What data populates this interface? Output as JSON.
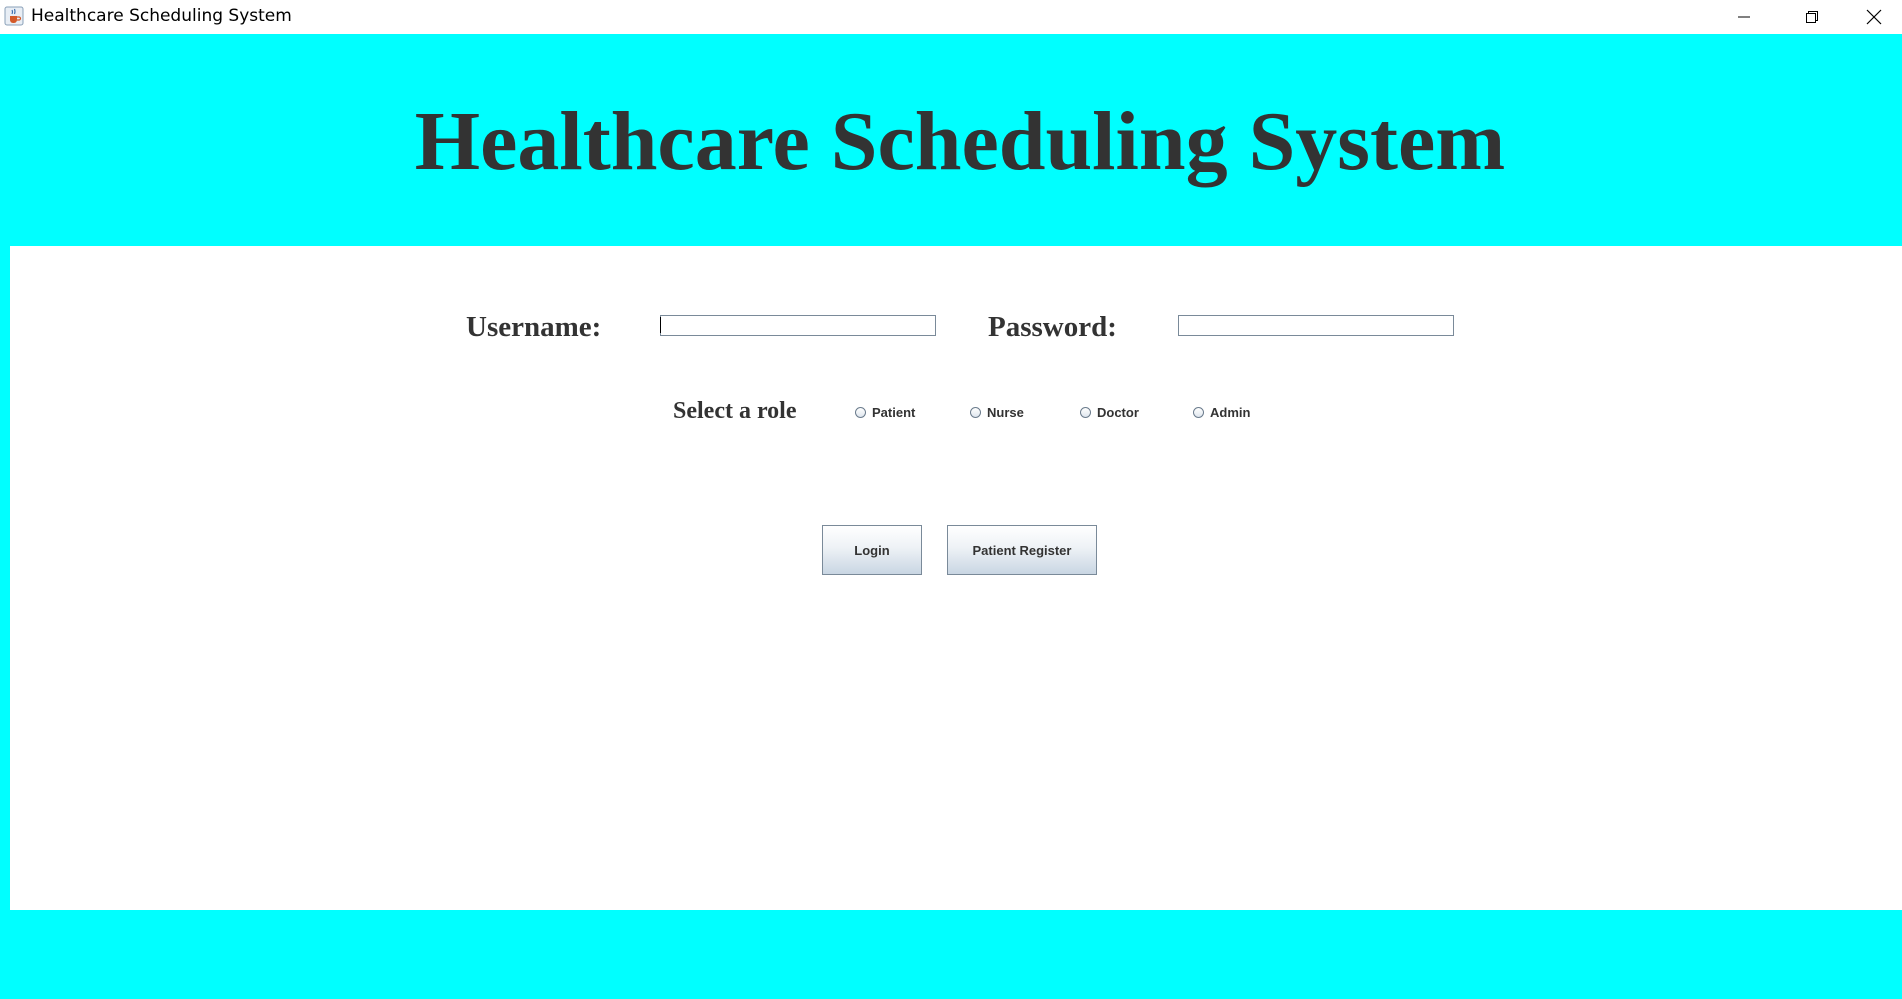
{
  "window": {
    "title": "Healthcare Scheduling System",
    "icon": "java-cup-icon",
    "controls": [
      "minimize-icon",
      "restore-icon",
      "close-icon"
    ]
  },
  "header": {
    "title": "Healthcare Scheduling System",
    "background": "#00ffff",
    "title_color": "#333333"
  },
  "form": {
    "username_label": "Username:",
    "username_value": "",
    "password_label": "Password:",
    "password_value": "",
    "role_label": "Select a role",
    "roles": [
      {
        "label": "Patient",
        "selected": false
      },
      {
        "label": "Nurse",
        "selected": false
      },
      {
        "label": "Doctor",
        "selected": false
      },
      {
        "label": "Admin",
        "selected": false
      }
    ]
  },
  "buttons": {
    "login": "Login",
    "register": "Patient Register"
  },
  "colors": {
    "accent": "#00ffff",
    "panel": "#ffffff",
    "text": "#333333"
  }
}
